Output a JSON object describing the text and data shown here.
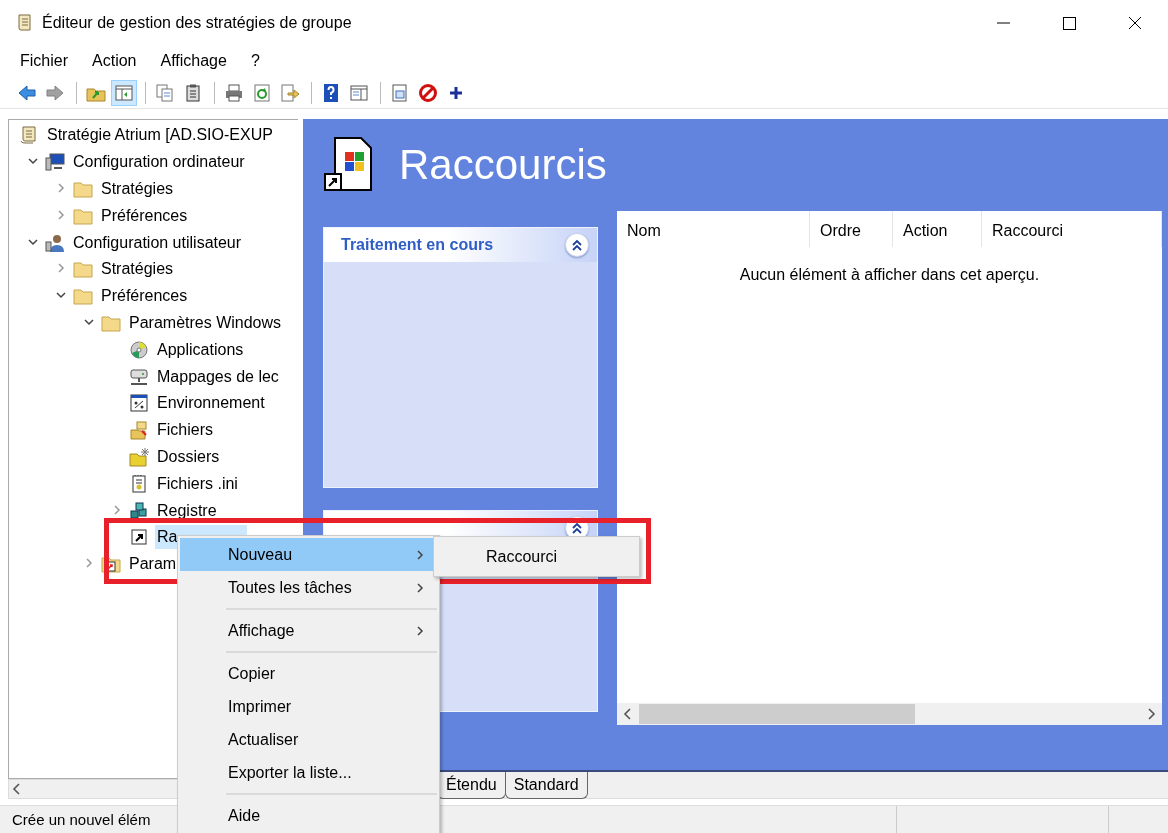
{
  "window": {
    "title": "Éditeur de gestion des stratégies de groupe"
  },
  "menu_bar": [
    "Fichier",
    "Action",
    "Affichage",
    "?"
  ],
  "toolbar": [
    {
      "kind": "back",
      "disabled": false,
      "pressed": false
    },
    {
      "kind": "forward",
      "disabled": true,
      "pressed": false
    },
    {
      "kind": "separator"
    },
    {
      "kind": "up",
      "disabled": false,
      "pressed": false
    },
    {
      "kind": "tree-pane",
      "disabled": false,
      "pressed": true
    },
    {
      "kind": "separator"
    },
    {
      "kind": "copy",
      "disabled": false,
      "pressed": false
    },
    {
      "kind": "paste",
      "disabled": false,
      "pressed": false
    },
    {
      "kind": "separator"
    },
    {
      "kind": "print",
      "disabled": false,
      "pressed": false
    },
    {
      "kind": "refresh",
      "disabled": false,
      "pressed": false
    },
    {
      "kind": "export",
      "disabled": false,
      "pressed": false
    },
    {
      "kind": "separator"
    },
    {
      "kind": "help",
      "disabled": false,
      "pressed": false
    },
    {
      "kind": "action-pane",
      "disabled": false,
      "pressed": false
    },
    {
      "kind": "separator"
    },
    {
      "kind": "properties",
      "disabled": false,
      "pressed": false
    },
    {
      "kind": "stop",
      "disabled": false,
      "pressed": false
    },
    {
      "kind": "add",
      "disabled": false,
      "pressed": false
    }
  ],
  "tree": {
    "root": {
      "label": "Stratégie Atrium [AD.SIO-EXUP",
      "kind": "scroll",
      "selected": false,
      "children": [
        {
          "label": "Configuration ordinateur",
          "kind": "computer",
          "expanded": true,
          "selected": false,
          "children": [
            {
              "label": "Stratégies",
              "kind": "folder",
              "expanded": false,
              "selected": false
            },
            {
              "label": "Préférences",
              "kind": "folder",
              "expanded": false,
              "selected": false
            }
          ]
        },
        {
          "label": "Configuration utilisateur",
          "kind": "user",
          "expanded": true,
          "selected": false,
          "children": [
            {
              "label": "Stratégies",
              "kind": "folder",
              "expanded": false,
              "selected": false
            },
            {
              "label": "Préférences",
              "kind": "folder",
              "expanded": true,
              "selected": false,
              "children": [
                {
                  "label": "Paramètres Windows",
                  "kind": "folder",
                  "expanded": true,
                  "selected": false,
                  "children": [
                    {
                      "label": "Applications",
                      "kind": "disc",
                      "selected": false
                    },
                    {
                      "label": "Mappages de lec",
                      "kind": "drive",
                      "selected": false
                    },
                    {
                      "label": "Environnement",
                      "kind": "env",
                      "selected": false
                    },
                    {
                      "label": "Fichiers",
                      "kind": "files",
                      "selected": false
                    },
                    {
                      "label": "Dossiers",
                      "kind": "folder-star",
                      "selected": false
                    },
                    {
                      "label": "Fichiers .ini",
                      "kind": "ini",
                      "selected": false
                    },
                    {
                      "label": "Registre",
                      "kind": "registry",
                      "expanded": false,
                      "selected": false
                    },
                    {
                      "label": "Ra",
                      "kind": "shortcut",
                      "selected": true
                    }
                  ]
                },
                {
                  "label": "Param",
                  "kind": "folder-shortcut",
                  "expanded": false,
                  "selected": false
                }
              ]
            }
          ]
        }
      ]
    }
  },
  "details": {
    "title": "Raccourcis",
    "panels": [
      {
        "title": "Traitement en cours",
        "expanded": true
      },
      {
        "expanded": true
      }
    ],
    "list": {
      "columns": [
        "Nom",
        "Ordre",
        "Action",
        "Raccourci"
      ],
      "empty_message": "Aucun élément à afficher dans cet aperçu."
    }
  },
  "view_tabs": [
    {
      "label": "Étendu"
    },
    {
      "label": "Standard"
    }
  ],
  "status_bar": {
    "text": "Crée un nouvel élém"
  },
  "context_menu": {
    "items": [
      {
        "kind": "item",
        "label": "Nouveau",
        "has_submenu": true,
        "selected": true
      },
      {
        "kind": "item",
        "label": "Toutes les tâches",
        "has_submenu": true,
        "selected": false
      },
      {
        "kind": "separator"
      },
      {
        "kind": "item",
        "label": "Affichage",
        "has_submenu": true,
        "selected": false
      },
      {
        "kind": "separator"
      },
      {
        "kind": "item",
        "label": "Copier",
        "has_submenu": false,
        "selected": false
      },
      {
        "kind": "item",
        "label": "Imprimer",
        "has_submenu": false,
        "selected": false
      },
      {
        "kind": "item",
        "label": "Actualiser",
        "has_submenu": false,
        "selected": false
      },
      {
        "kind": "item",
        "label": "Exporter la liste...",
        "has_submenu": false,
        "selected": false
      },
      {
        "kind": "separator"
      },
      {
        "kind": "item",
        "label": "Aide",
        "has_submenu": false,
        "selected": false
      }
    ]
  },
  "submenu": {
    "items": [
      {
        "label": "Raccourci",
        "selected": false
      }
    ]
  },
  "annotations": [
    {
      "kind": "frame"
    }
  ]
}
